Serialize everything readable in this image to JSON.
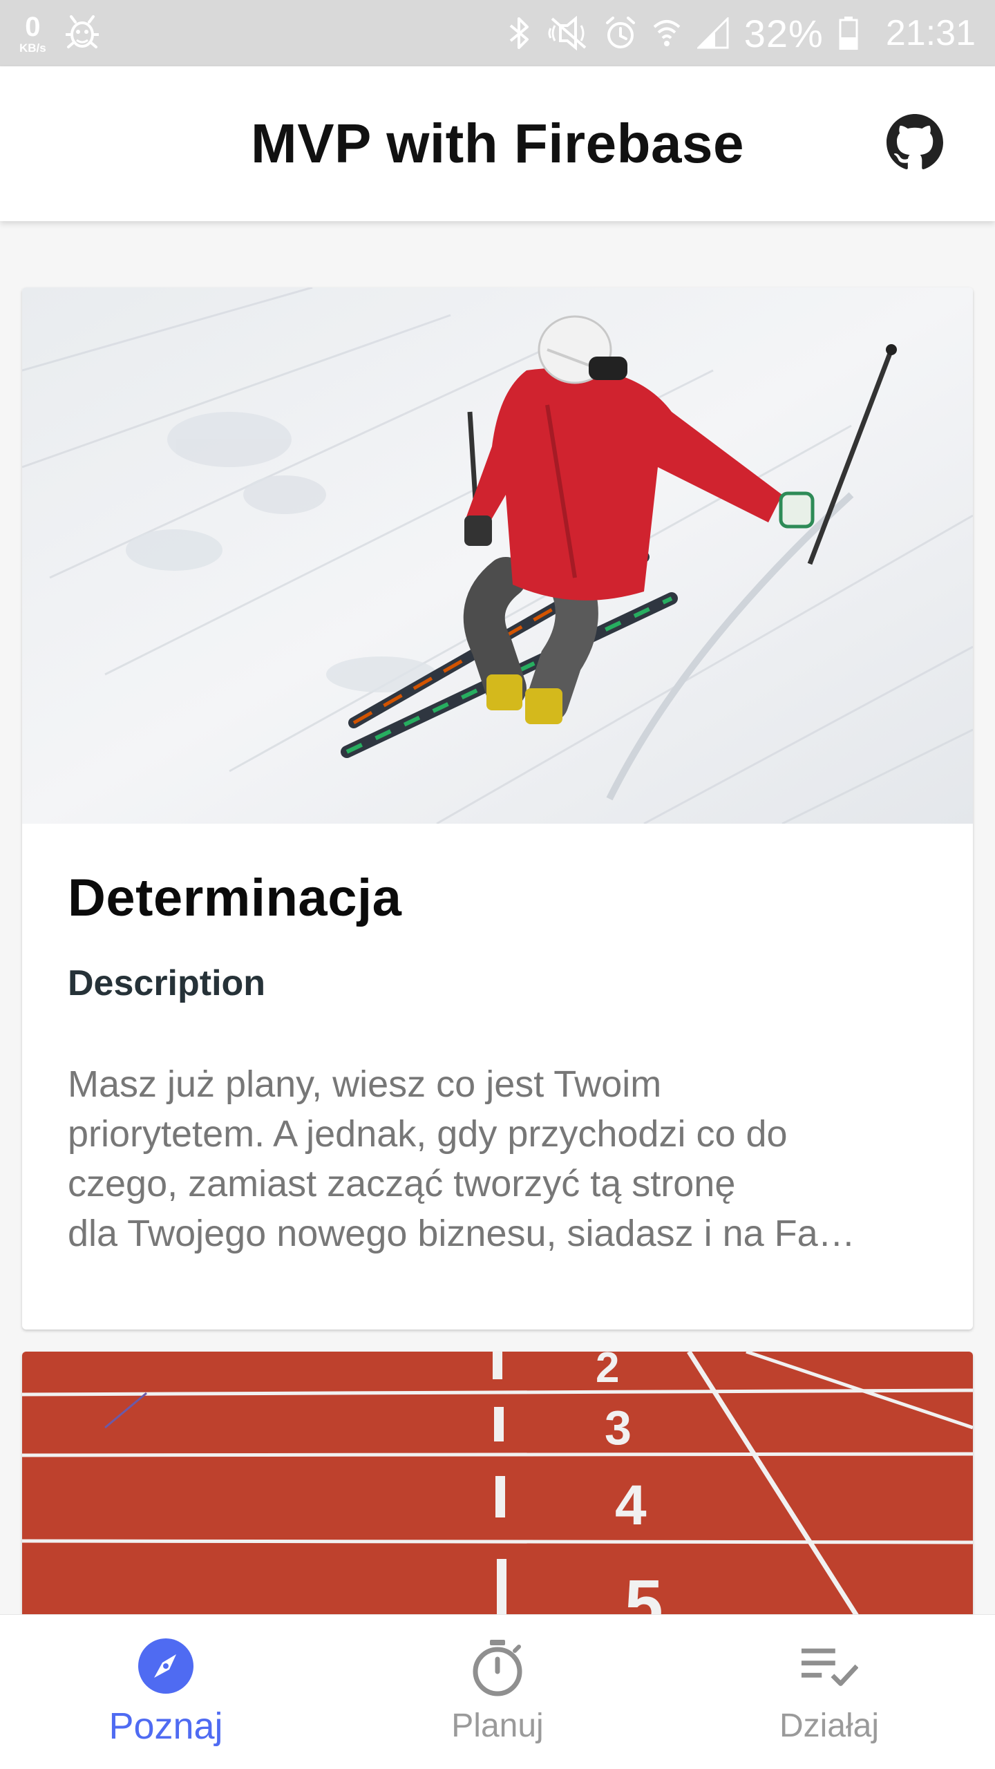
{
  "status_bar": {
    "net_speed_value": "0",
    "net_speed_unit": "KB/s",
    "battery": "32%",
    "time": "21:31",
    "icons": [
      "bug-icon",
      "bluetooth-icon",
      "mute-icon",
      "alarm-icon",
      "wifi-icon",
      "signal-icon",
      "battery-icon"
    ]
  },
  "app_bar": {
    "title": "MVP with Firebase",
    "action_icon": "github-icon"
  },
  "cards": [
    {
      "image": "skier-photo",
      "title": "Determinacja",
      "subtitle": "Description",
      "description_lines": [
        "Masz już plany, wiesz co jest Twoim",
        "priorytetem. A jednak, gdy przychodzi co do",
        "czego, zamiast zacząć tworzyć tą stronę",
        "dla Twojego nowego biznesu, siadasz i na Fa…"
      ]
    },
    {
      "image": "running-track-photo",
      "lane_numbers": [
        "2",
        "3",
        "4",
        "5"
      ]
    }
  ],
  "bottom_nav": {
    "items": [
      {
        "label": "Poznaj",
        "icon": "compass-icon",
        "active": true
      },
      {
        "label": "Planuj",
        "icon": "stopwatch-icon",
        "active": false
      },
      {
        "label": "Działaj",
        "icon": "checklist-icon",
        "active": false
      }
    ]
  },
  "colors": {
    "accent": "#4f6bf2",
    "inactive": "#9a9a9a",
    "status_bar_bg": "#d9d9d9",
    "track_red": "#c2432f"
  }
}
